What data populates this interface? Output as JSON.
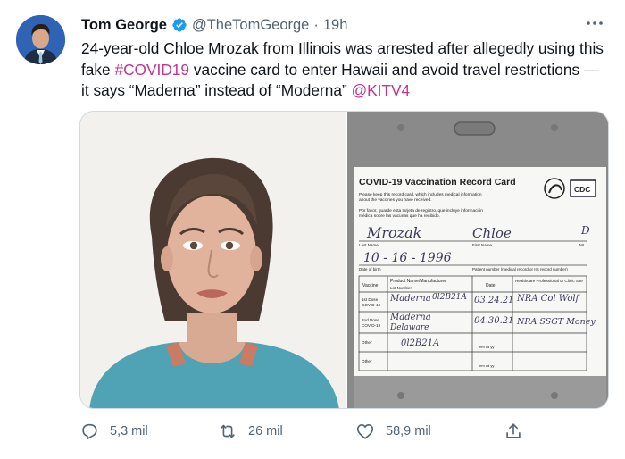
{
  "tweet": {
    "author_name": "Tom George",
    "author_handle": "@TheTomGeorge",
    "separator": "·",
    "time": "19h",
    "text_part1": "24-year-old Chloe Mrozak from Illinois was arrested after allegedly using this fake ",
    "hashtag": "#COVID19",
    "text_part2": " vaccine card to enter Hawaii and avoid travel restrictions — it says “Maderna” instead of “Moderna” ",
    "mention": "@KITV4"
  },
  "card": {
    "title": "COVID-19 Vaccination Record Card",
    "note_en": "Please keep this record card, which includes medical information about the vaccines you have received.",
    "note_es": "Por favor, guarde esta tarjeta de registro, que incluye información médica sobre las vacunas que ha recibido.",
    "cdc_label": "CDC",
    "last_name_label": "Last Name",
    "first_name_label": "First Name",
    "mi_label": "MI",
    "dob_label": "Date of birth",
    "patient_number_label": "Patient number (medical record or IIS record number)",
    "col_vaccine": "Vaccine",
    "col_product": "Product Name/Manufacturer",
    "col_lot": "Lot Number",
    "col_date": "Date",
    "col_provider": "Healthcare Professional or Clinic Site",
    "row1_label_a": "1st Dose",
    "row1_label_b": "COVID-19",
    "row2_label_a": "2nd Dose",
    "row2_label_b": "COVID-19",
    "row3_label": "Other",
    "row4_label": "Other",
    "date_hint": "mm   dd   yy",
    "hw_last_name": "Mrozak",
    "hw_first_name": "Chloe",
    "hw_mi": "D",
    "hw_dob": "10 - 16 - 1996",
    "hw_product1": "Maderna",
    "hw_lot1": "0l2B21A",
    "hw_date1": "03.24.21",
    "hw_prov1": "NRA Col Wolf",
    "hw_product2": "Maderna",
    "hw_lot2": "Delaware",
    "hw_date2": "04.30.21",
    "hw_prov2": "NRA SSGT Money",
    "hw_lot3": "0l2B21A"
  },
  "actions": {
    "replies": "5,3 mil",
    "retweets": "26 mil",
    "likes": "58,9 mil"
  },
  "icons": {
    "verified": "verified-badge-icon",
    "more": "more-icon",
    "reply": "reply-icon",
    "retweet": "retweet-icon",
    "like": "heart-icon",
    "share": "share-icon"
  },
  "colors": {
    "link": "#c4338d",
    "verified": "#1d9bf0",
    "muted": "#536471"
  }
}
